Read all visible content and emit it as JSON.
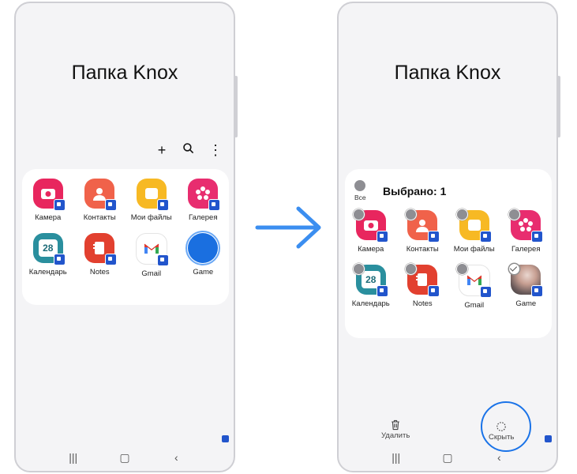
{
  "left_screen": {
    "title": "Папка Knox",
    "toolbar": {
      "add_icon": "plus-icon",
      "search_icon": "search-icon",
      "more_icon": "more-vertical-icon"
    },
    "apps": [
      {
        "label": "Камера",
        "icon": "camera-icon",
        "color": "#e8265e"
      },
      {
        "label": "Контакты",
        "icon": "contacts-icon",
        "color": "#f0624a"
      },
      {
        "label": "Мои файлы",
        "icon": "folder-icon",
        "color": "#f7b924"
      },
      {
        "label": "Галерея",
        "icon": "gallery-icon",
        "color": "#e82d6f"
      },
      {
        "label": "Календарь",
        "icon": "calendar-icon",
        "color": "#2a8f9e",
        "text": "28"
      },
      {
        "label": "Notes",
        "icon": "notes-icon",
        "color": "#e2402f"
      },
      {
        "label": "Gmail",
        "icon": "gmail-icon",
        "color": "#ffffff"
      },
      {
        "label": "Game",
        "icon": "game-icon",
        "color": "#1a6fe0"
      }
    ]
  },
  "right_screen": {
    "title": "Папка Knox",
    "select_all_label": "Все",
    "selected_text": "Выбрано: 1",
    "apps": [
      {
        "label": "Камера",
        "icon": "camera-icon",
        "color": "#e8265e",
        "selected": false
      },
      {
        "label": "Контакты",
        "icon": "contacts-icon",
        "color": "#f0624a",
        "selected": false
      },
      {
        "label": "Мои файлы",
        "icon": "folder-icon",
        "color": "#f7b924",
        "selected": false
      },
      {
        "label": "Галерея",
        "icon": "gallery-icon",
        "color": "#e82d6f",
        "selected": false
      },
      {
        "label": "Календарь",
        "icon": "calendar-icon",
        "color": "#2a8f9e",
        "text": "28",
        "selected": false
      },
      {
        "label": "Notes",
        "icon": "notes-icon",
        "color": "#e2402f",
        "selected": false
      },
      {
        "label": "Gmail",
        "icon": "gmail-icon",
        "color": "#ffffff",
        "selected": false
      },
      {
        "label": "Game",
        "icon": "game-icon",
        "color": "#8a6a62",
        "selected": true
      }
    ],
    "actions": {
      "delete_label": "Удалить",
      "hide_label": "Скрыть"
    }
  },
  "navbar": {
    "recent_icon": "recents-icon",
    "home_icon": "home-icon",
    "back_icon": "back-icon"
  },
  "colors": {
    "highlight": "#1a73e8",
    "arrow": "#3b8ef0",
    "badge": "#2255cc"
  }
}
